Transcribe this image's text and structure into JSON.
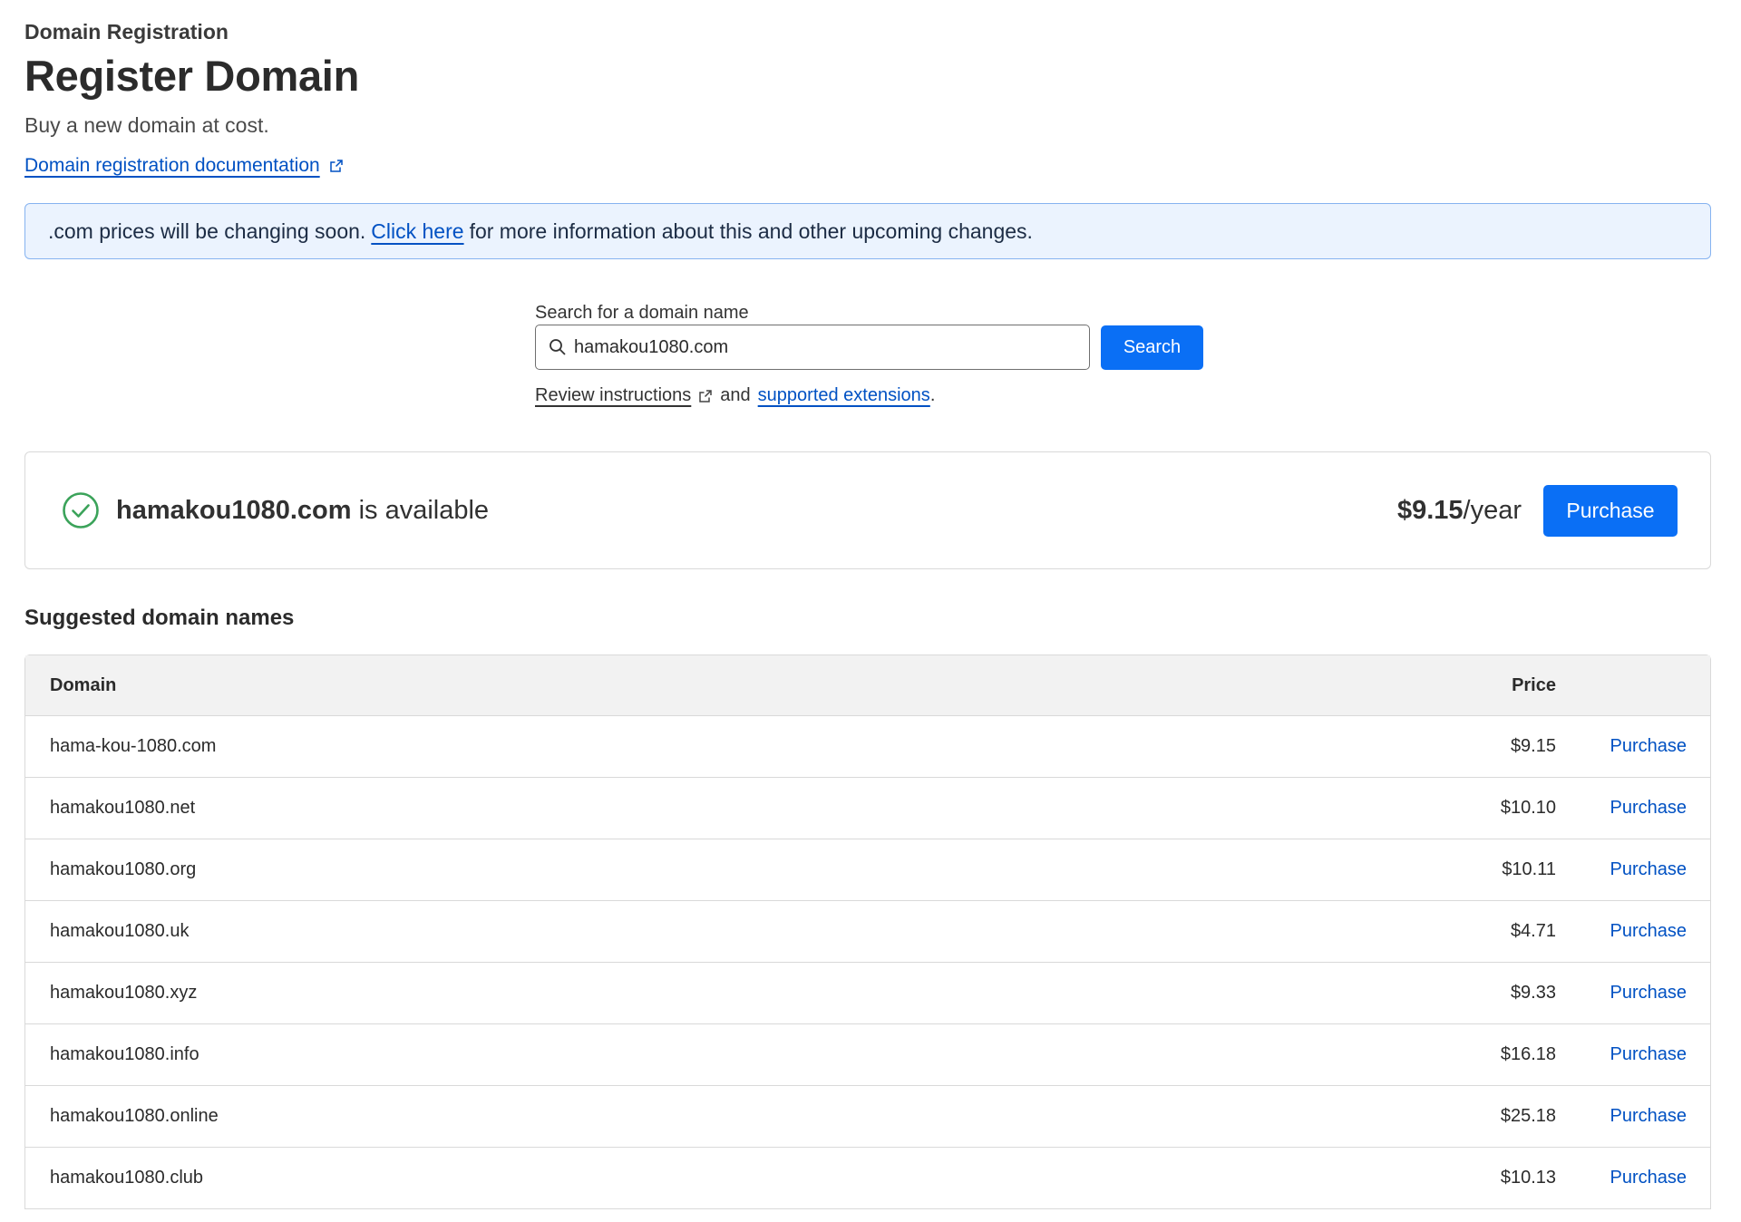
{
  "header": {
    "eyebrow": "Domain Registration",
    "title": "Register Domain",
    "subtitle": "Buy a new domain at cost.",
    "doc_link": "Domain registration documentation"
  },
  "banner": {
    "text_before": ".com prices will be changing soon.",
    "link": "Click here",
    "text_after": "for more information about this and other upcoming changes."
  },
  "search": {
    "label": "Search for a domain name",
    "value": "hamakou1080.com",
    "button": "Search",
    "help_link": "Review instructions",
    "help_and": "and",
    "help_ext_link": "supported extensions",
    "help_end": "."
  },
  "result": {
    "domain": "hamakou1080.com",
    "status": "is available",
    "price": "$9.15",
    "unit": "/year",
    "button": "Purchase"
  },
  "suggestions": {
    "title": "Suggested domain names",
    "columns": {
      "domain": "Domain",
      "price": "Price"
    },
    "rows": [
      {
        "domain": "hama-kou-1080.com",
        "price": "$9.15",
        "action": "Purchase"
      },
      {
        "domain": "hamakou1080.net",
        "price": "$10.10",
        "action": "Purchase"
      },
      {
        "domain": "hamakou1080.org",
        "price": "$10.11",
        "action": "Purchase"
      },
      {
        "domain": "hamakou1080.uk",
        "price": "$4.71",
        "action": "Purchase"
      },
      {
        "domain": "hamakou1080.xyz",
        "price": "$9.33",
        "action": "Purchase"
      },
      {
        "domain": "hamakou1080.info",
        "price": "$16.18",
        "action": "Purchase"
      },
      {
        "domain": "hamakou1080.online",
        "price": "$25.18",
        "action": "Purchase"
      },
      {
        "domain": "hamakou1080.club",
        "price": "$10.13",
        "action": "Purchase"
      }
    ]
  },
  "colors": {
    "primary": "#0a6ff5",
    "link": "#0051c3",
    "success": "#3ba35a",
    "banner_bg": "#ebf3fe",
    "banner_border": "#86b3f0"
  },
  "icons": {
    "doc_link": "external-link-icon",
    "search": "search-icon",
    "result": "check-circle-icon"
  }
}
